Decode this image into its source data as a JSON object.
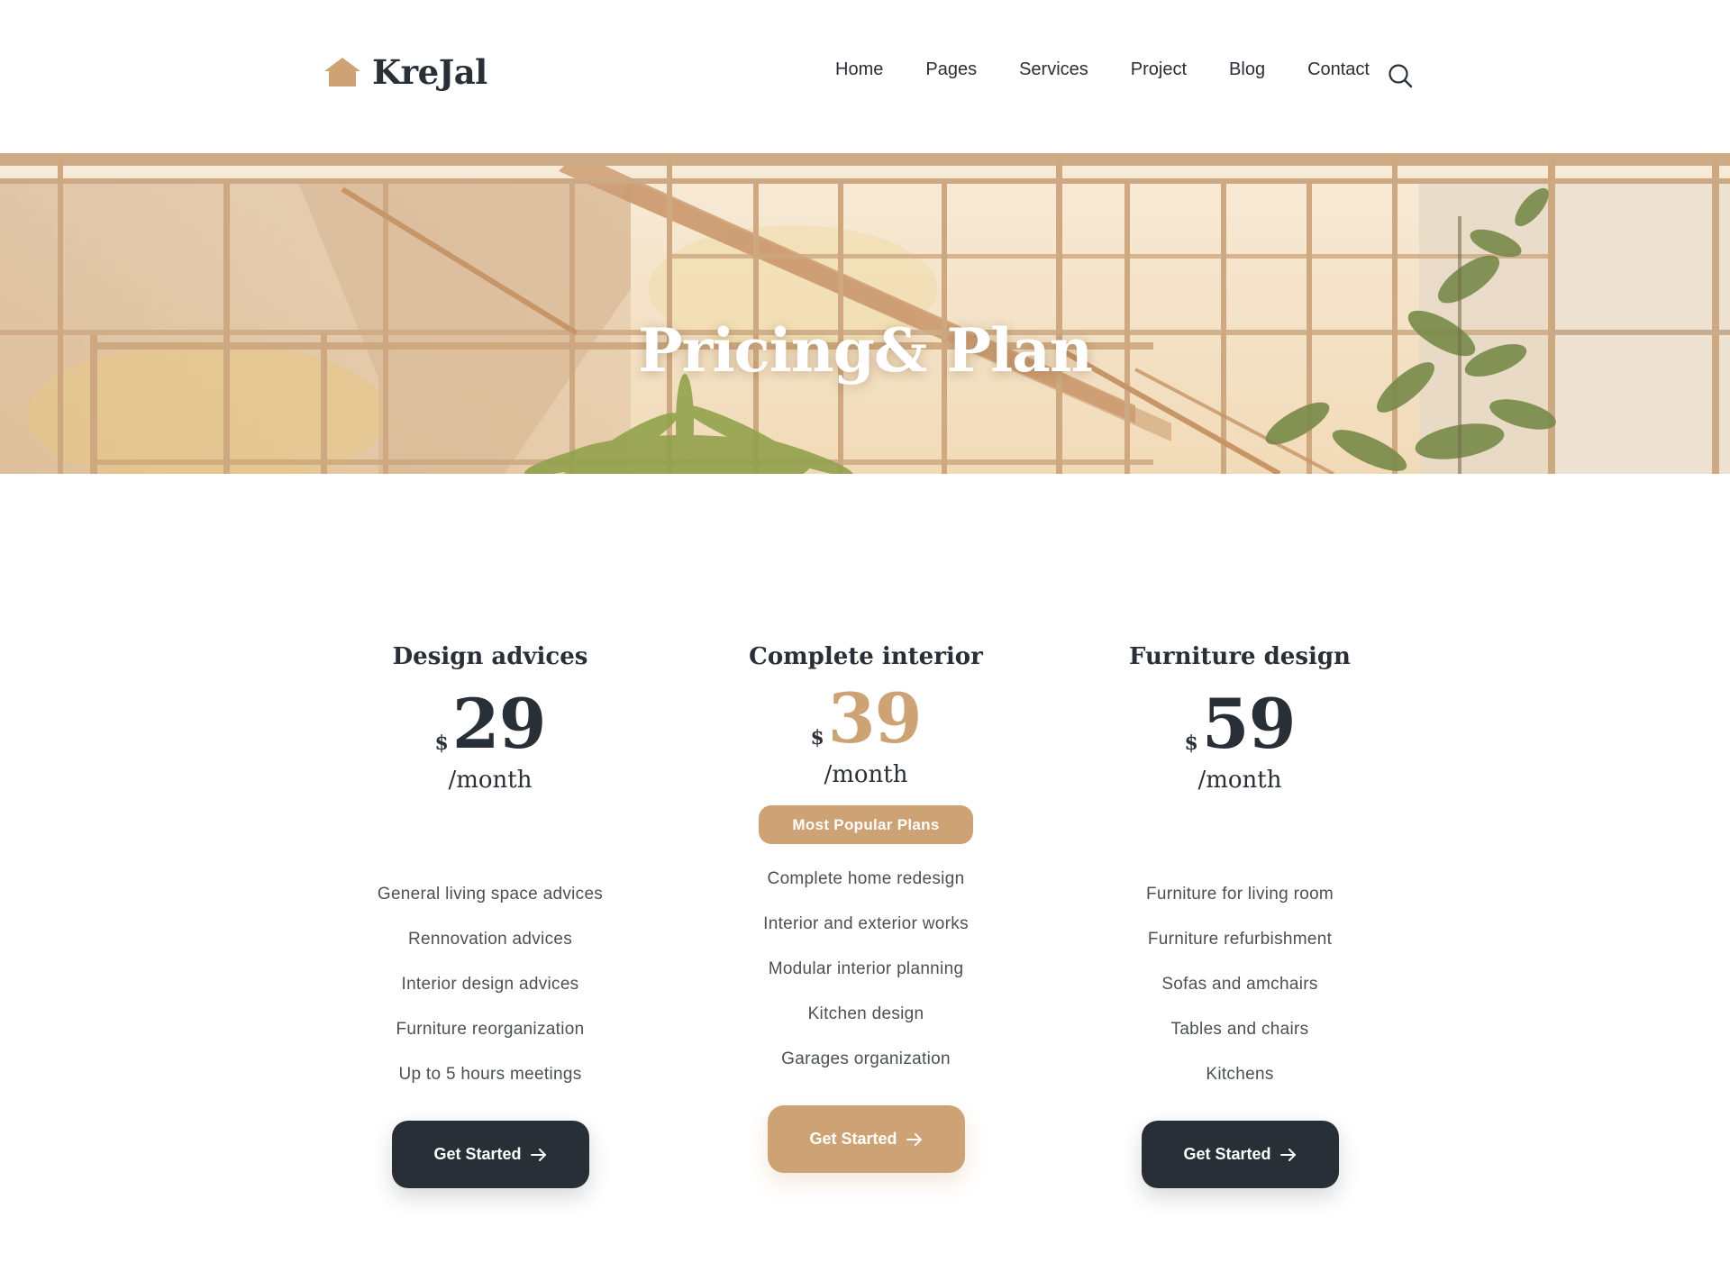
{
  "header": {
    "brand": "KreJal",
    "nav": [
      "Home",
      "Pages",
      "Services",
      "Project",
      "Blog",
      "Contact"
    ]
  },
  "hero": {
    "title": "Pricing& Plan"
  },
  "pricing": {
    "plans": [
      {
        "name": "Design advices",
        "currency": "$",
        "price": "29",
        "period": "/month",
        "features": [
          "General living space advices",
          "Rennovation advices",
          "Interior design advices",
          "Furniture reorganization",
          "Up to 5 hours meetings"
        ],
        "cta": "Get Started"
      },
      {
        "name": "Complete interior",
        "currency": "$",
        "price": "39",
        "period": "/month",
        "badge": "Most Popular Plans",
        "features": [
          "Complete home redesign",
          "Interior and exterior works",
          "Modular interior planning",
          "Kitchen design",
          "Garages organization"
        ],
        "cta": "Get Started"
      },
      {
        "name": "Furniture design",
        "currency": "$",
        "price": "59",
        "period": "/month",
        "features": [
          "Furniture for living room",
          "Furniture refurbishment",
          "Sofas and amchairs",
          "Tables and chairs",
          "Kitchens"
        ],
        "cta": "Get Started"
      }
    ]
  },
  "colors": {
    "accent": "#cda274",
    "dark": "#292f36",
    "text": "#4d5053"
  }
}
